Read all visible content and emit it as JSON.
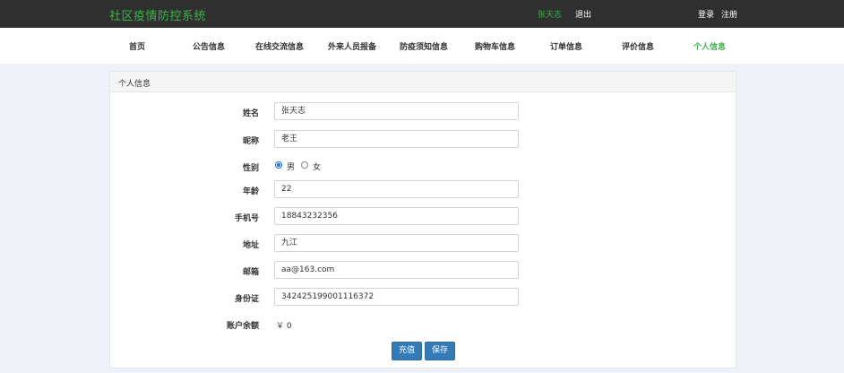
{
  "header": {
    "brand": "社区疫情防控系统",
    "username": "张天志",
    "logout": "退出",
    "login": "登录",
    "register": "注册"
  },
  "nav": {
    "items": [
      {
        "label": "首页",
        "active": false
      },
      {
        "label": "公告信息",
        "active": false
      },
      {
        "label": "在线交流信息",
        "active": false
      },
      {
        "label": "外来人员报备",
        "active": false
      },
      {
        "label": "防疫须知信息",
        "active": false
      },
      {
        "label": "购物车信息",
        "active": false
      },
      {
        "label": "订单信息",
        "active": false
      },
      {
        "label": "评价信息",
        "active": false
      },
      {
        "label": "个人信息",
        "active": true
      }
    ]
  },
  "panel": {
    "title": "个人信息"
  },
  "form": {
    "name_label": "姓名",
    "name_value": "张天志",
    "nickname_label": "昵称",
    "nickname_value": "老王",
    "gender_label": "性别",
    "gender_options": [
      {
        "label": "男",
        "checked": true
      },
      {
        "label": "女",
        "checked": false
      }
    ],
    "age_label": "年龄",
    "age_value": "22",
    "phone_label": "手机号",
    "phone_value": "18843232356",
    "address_label": "地址",
    "address_value": "九江",
    "email_label": "邮箱",
    "email_value": "aa@163.com",
    "idcard_label": "身份证",
    "idcard_value": "342425199001116372",
    "balance_label": "账户余额",
    "balance_value": "￥ 0"
  },
  "buttons": {
    "recharge": "充值",
    "save": "保存"
  },
  "colors": {
    "accent_green": "#3bb54a",
    "topbar": "#2f2f2f",
    "button_blue": "#337ab7"
  }
}
